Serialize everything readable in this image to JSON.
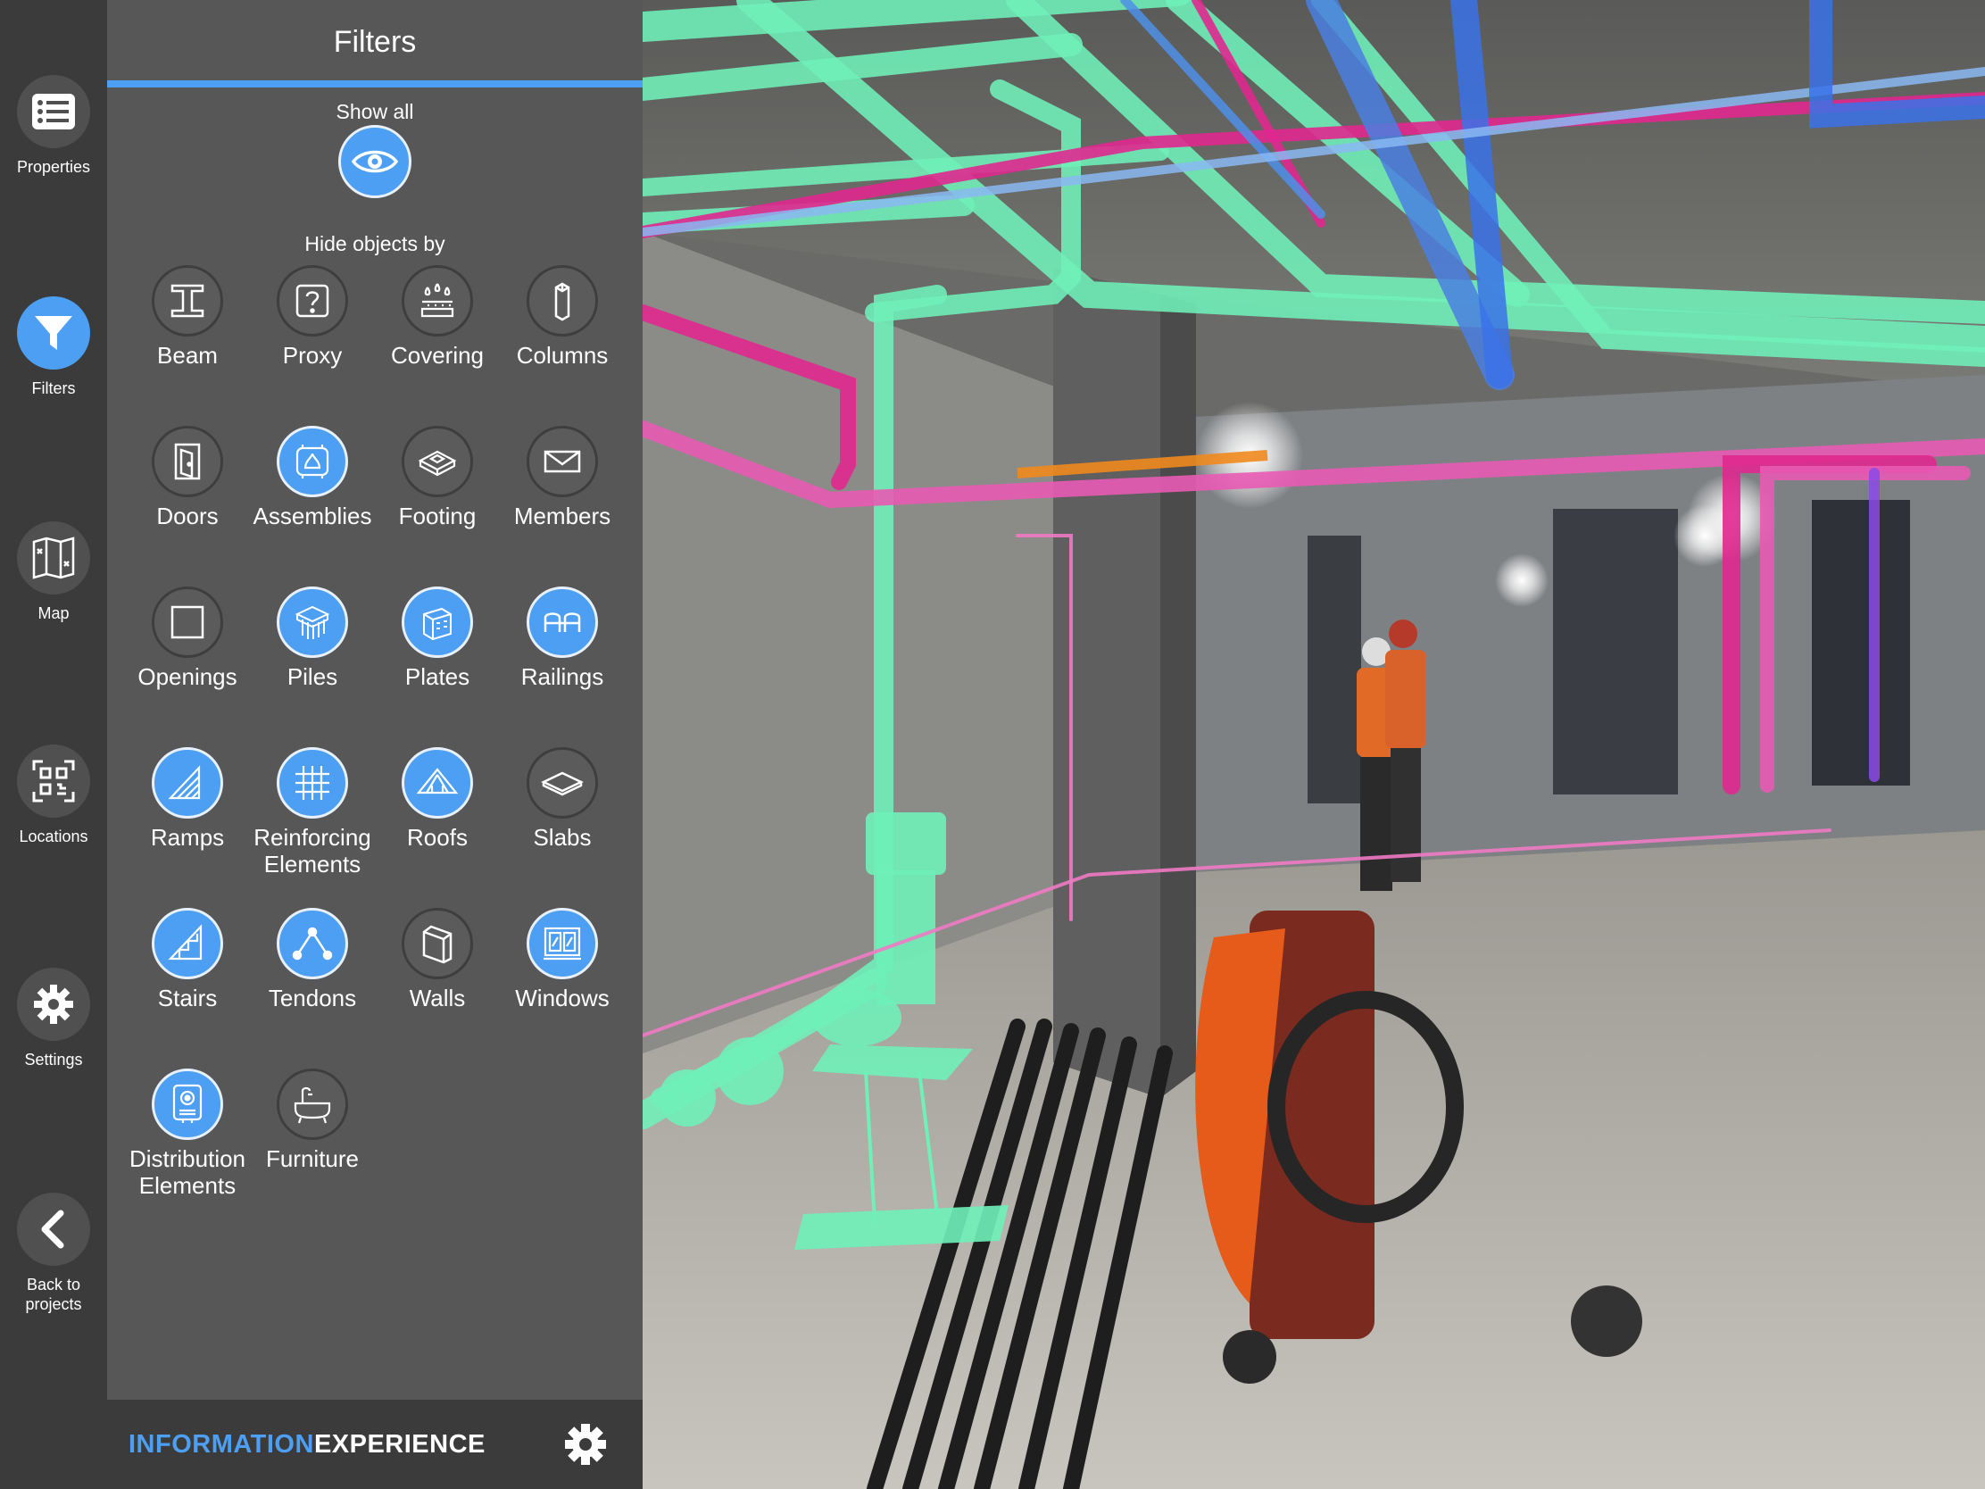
{
  "rail": {
    "items": [
      {
        "label": "Properties",
        "icon": "list-icon",
        "active": false
      },
      {
        "label": "Filters",
        "icon": "filter-icon",
        "active": true
      },
      {
        "label": "Map",
        "icon": "map-icon",
        "active": false
      },
      {
        "label": "Locations",
        "icon": "qr-code-icon",
        "active": false
      },
      {
        "label": "Settings",
        "icon": "gear-icon",
        "active": false
      },
      {
        "label_line1": "Back to",
        "label_line2": "projects",
        "icon": "chevron-left-icon"
      }
    ]
  },
  "panel": {
    "title": "Filters",
    "show_all_label": "Show all",
    "hide_by_label": "Hide objects by",
    "filters": [
      {
        "line1": "Beam",
        "line2": "",
        "icon": "beam-icon",
        "enabled": false
      },
      {
        "line1": "Proxy",
        "line2": "",
        "icon": "proxy-icon",
        "enabled": false
      },
      {
        "line1": "Covering",
        "line2": "",
        "icon": "covering-icon",
        "enabled": false
      },
      {
        "line1": "Columns",
        "line2": "",
        "icon": "column-icon",
        "enabled": false
      },
      {
        "line1": "Doors",
        "line2": "",
        "icon": "door-icon",
        "enabled": false
      },
      {
        "line1": "Assemblies",
        "line2": "",
        "icon": "assembly-icon",
        "enabled": true
      },
      {
        "line1": "Footing",
        "line2": "",
        "icon": "footing-icon",
        "enabled": false
      },
      {
        "line1": "Members",
        "line2": "",
        "icon": "members-icon",
        "enabled": false
      },
      {
        "line1": "Openings",
        "line2": "",
        "icon": "opening-icon",
        "enabled": false
      },
      {
        "line1": "Piles",
        "line2": "",
        "icon": "piles-icon",
        "enabled": true
      },
      {
        "line1": "Plates",
        "line2": "",
        "icon": "plates-icon",
        "enabled": true
      },
      {
        "line1": "Railings",
        "line2": "",
        "icon": "railing-icon",
        "enabled": true
      },
      {
        "line1": "Ramps",
        "line2": "",
        "icon": "ramp-icon",
        "enabled": true
      },
      {
        "line1": "Reinforcing",
        "line2": "Elements",
        "icon": "grid-icon",
        "enabled": true
      },
      {
        "line1": "Roofs",
        "line2": "",
        "icon": "roof-icon",
        "enabled": true
      },
      {
        "line1": "Slabs",
        "line2": "",
        "icon": "slab-icon",
        "enabled": false
      },
      {
        "line1": "Stairs",
        "line2": "",
        "icon": "stairs-icon",
        "enabled": true
      },
      {
        "line1": "Tendons",
        "line2": "",
        "icon": "tendon-icon",
        "enabled": true
      },
      {
        "line1": "Walls",
        "line2": "",
        "icon": "wall-icon",
        "enabled": false
      },
      {
        "line1": "Windows",
        "line2": "",
        "icon": "window-icon",
        "enabled": true
      },
      {
        "line1": "Distribution",
        "line2": "Elements",
        "icon": "distribution-icon",
        "enabled": true
      },
      {
        "line1": "Furniture",
        "line2": "",
        "icon": "furniture-icon",
        "enabled": false
      }
    ]
  },
  "footer": {
    "brand_part1": "INFORMATION",
    "brand_part2": "EXPERIENCE",
    "icon": "gear-icon"
  },
  "colors": {
    "accent": "#4c9ff2",
    "rail_bg": "#3b3b3b",
    "panel_bg": "#575757",
    "pipe_green": "#6ff0b8",
    "pipe_magenta": "#e0288f",
    "pipe_blue": "#4e8fe8"
  }
}
